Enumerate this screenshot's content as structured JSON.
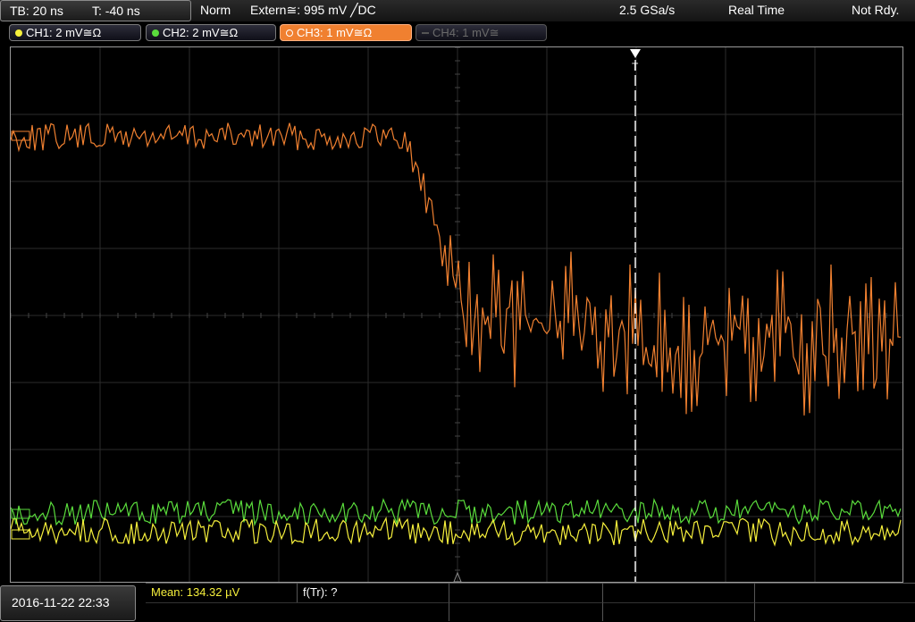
{
  "status": {
    "timebase": "TB: 20 ns",
    "trigger_pos": "T: -40 ns",
    "mode": "Norm",
    "trigger": "Extern≅: 995 mV ╱DC",
    "sample_rate": "2.5 GSa/s",
    "acq_mode": "Real Time",
    "state": "Not Rdy."
  },
  "channels": [
    {
      "label": "CH1: 2 mV≅Ω",
      "color": "#f6f03c",
      "state": "on"
    },
    {
      "label": "CH2: 2 mV≅Ω",
      "color": "#5adc3c",
      "state": "on"
    },
    {
      "label": "CH3: 1 mV≅Ω",
      "color": "#f08030",
      "state": "selected"
    },
    {
      "label": "CH4: 1 mV≅",
      "color": "#6a6a6a",
      "state": "off"
    }
  ],
  "timestamp": "2016-11-22 22:33",
  "measurements": {
    "mean": "Mean: 134.32 µV",
    "ftr": "f(Tr): ?"
  },
  "colors": {
    "grid": "#2c2c2c",
    "trace_ch1": "#f6f03c",
    "trace_ch2": "#5adc3c",
    "trace_ch3": "#f08030",
    "trigger_marker": "#ffffff"
  }
}
